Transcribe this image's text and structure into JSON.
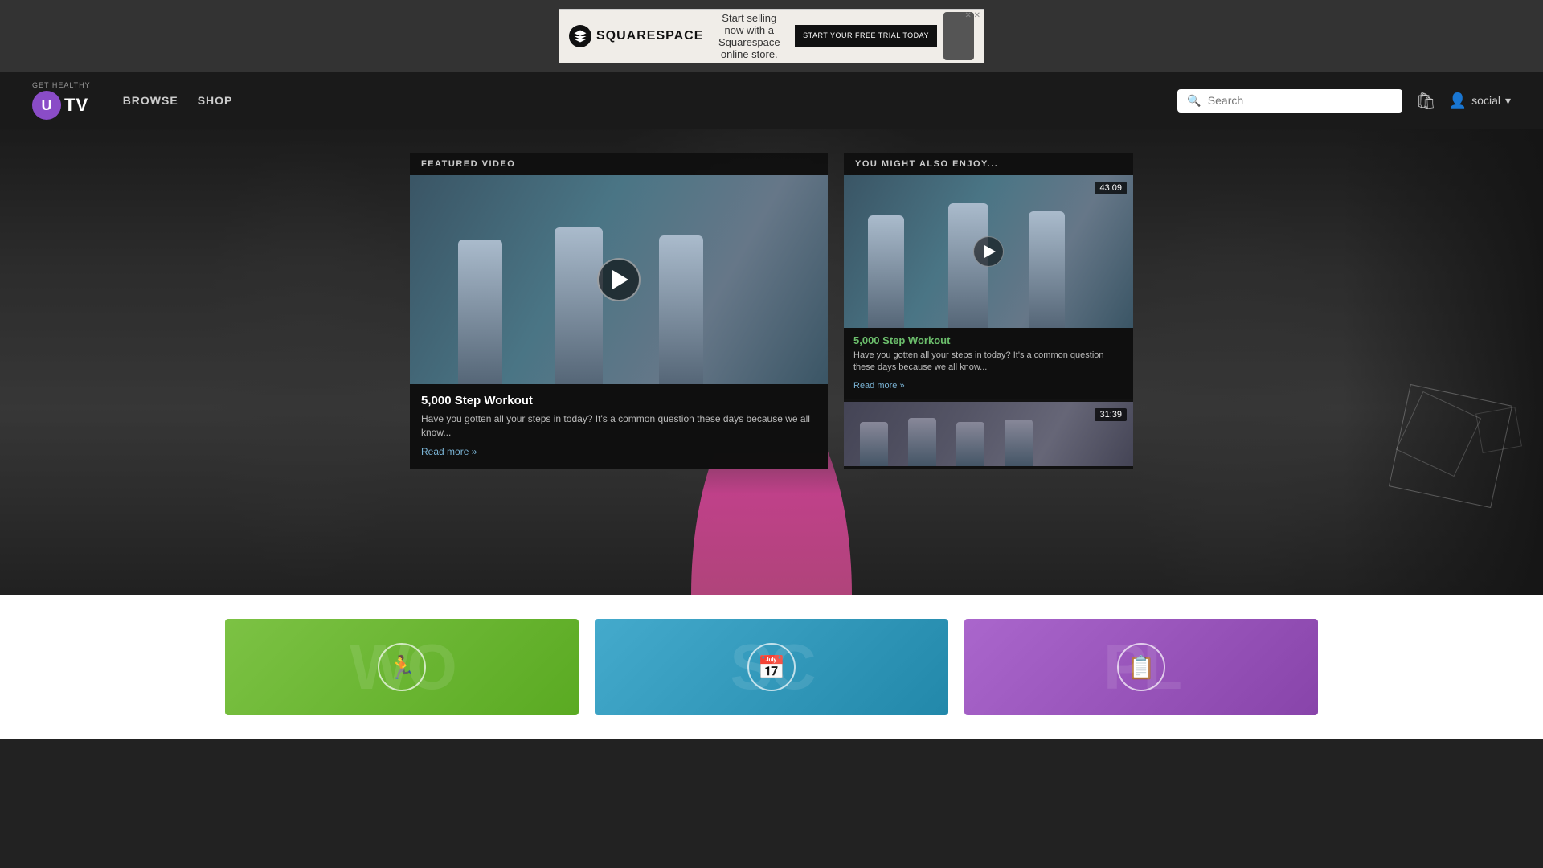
{
  "ad": {
    "brand": "SQUARESPACE",
    "tagline": "Start selling now with a Squarespace online store.",
    "cta": "START YOUR FREE TRIAL TODAY",
    "close_label": "✕ Ad"
  },
  "navbar": {
    "brand_prefix": "GET HEALTHY",
    "brand_u": "U",
    "brand_tv": "TV",
    "browse_label": "BROWSE",
    "shop_label": "SHOP",
    "search_placeholder": "Search",
    "user_label": "social"
  },
  "featured": {
    "section_label": "FEATURED VIDEO",
    "title": "5,000 Step Workout",
    "description": "Have you gotten all your steps in today? It's a common question these days because we all know...",
    "read_more": "Read more »"
  },
  "also_enjoy": {
    "section_label": "YOU MIGHT ALSO ENJOY...",
    "video1": {
      "title": "5,000 Step Workout",
      "description": "Have you gotten all your steps in today? It's a common question these days because we all know...",
      "read_more": "Read more »",
      "duration": "43:09"
    },
    "video2": {
      "duration": "31:39"
    }
  },
  "categories": {
    "items": [
      {
        "id": "workouts",
        "color": "green",
        "icon": "🏃"
      },
      {
        "id": "schedule",
        "color": "blue",
        "icon": "📅"
      },
      {
        "id": "plans",
        "color": "purple",
        "icon": "📋"
      }
    ]
  }
}
